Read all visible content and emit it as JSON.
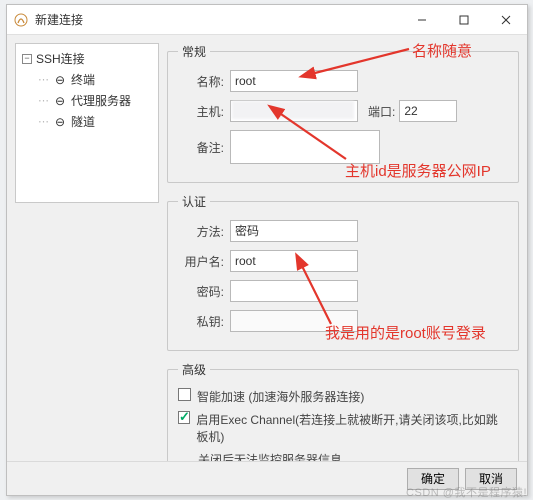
{
  "window": {
    "title": "新建连接"
  },
  "sidebar": {
    "root_label": "SSH连接",
    "items": [
      {
        "label": "终端"
      },
      {
        "label": "代理服务器"
      },
      {
        "label": "隧道"
      }
    ]
  },
  "sections": {
    "general": {
      "legend": "常规",
      "name_label": "名称:",
      "name_value": "root",
      "host_label": "主机:",
      "host_value": "",
      "port_label": "端口:",
      "port_value": "22",
      "note_label": "备注:",
      "note_value": ""
    },
    "auth": {
      "legend": "认证",
      "method_label": "方法:",
      "method_value": "密码",
      "user_label": "用户名:",
      "user_value": "root",
      "password_label": "密码:",
      "password_value": "",
      "key_label": "私钥:",
      "key_value": ""
    },
    "advanced": {
      "legend": "高级",
      "accel_label": "智能加速 (加速海外服务器连接)",
      "exec_label": "启用Exec Channel(若连接上就被断开,请关闭该项,比如跳板机)",
      "exec_sub": "关闭后无法监控服务器信息"
    }
  },
  "footer": {
    "ok": "确定",
    "cancel": "取消"
  },
  "annotations": {
    "a1": "名称随意",
    "a2": "主机id是服务器公网IP",
    "a3": "我是用的是root账号登录"
  },
  "watermark": "CSDN @我不是程序猿!"
}
